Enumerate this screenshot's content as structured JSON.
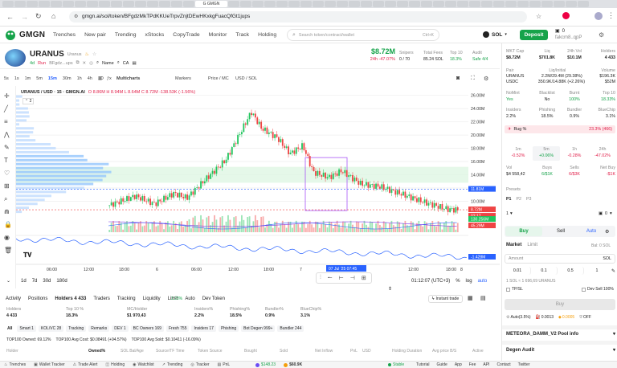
{
  "browser": {
    "tabs_count": 60,
    "active_tab": "G GMGN",
    "url": "gmgn.ai/sol/token/BFgdzMkTPdKKUeTrpvZnjtDEwHKxkgFuacQfGt1jups"
  },
  "app": {
    "logo": "GMGN",
    "nav": [
      "Trenches",
      "New pair",
      "Trending",
      "xStocks",
      "CopyTrade",
      "Monitor",
      "Track",
      "Holding"
    ],
    "search_placeholder": "Search token/contract/wallet",
    "search_shortcut": "Ctrl+K",
    "chain": "SOL",
    "deposit": "Deposit",
    "wallet_balance": "0",
    "wallet_name": "fakcm8..qpP"
  },
  "token": {
    "symbol": "URANUS",
    "name": "Uranus",
    "age": "4d",
    "run": "Run",
    "address": "BFgdz...ups",
    "name_label": "Name",
    "ca_label": "CA",
    "price": "$8.72M",
    "change": "24h -47.07%",
    "snipers_label": "Snipers",
    "snipers": "0 / 70",
    "total_fees_label": "Total Fees",
    "total_fees": "85.24 SOL",
    "top10_label": "Top 10",
    "top10": "18.3%",
    "audit_label": "Audit",
    "audit": "Safe 4/4"
  },
  "chart": {
    "intervals": [
      "5s",
      "1s",
      "1m",
      "5m",
      "15m",
      "30m",
      "1h",
      "4h",
      "1D"
    ],
    "active_interval": "15m",
    "toolbar": [
      "Multicharts",
      "Markers",
      "Price / MC",
      "USD / SOL"
    ],
    "legend": "URANUS / USD · 15 · GMGN.AI",
    "ohlc": "O 8.86M H 8.94M L 8.64M C 8.72M -138.53K (-1.56%)",
    "legend_count": "2",
    "price_axis": [
      "26.00M",
      "24.00M",
      "22.00M",
      "20.00M",
      "18.00M",
      "16.00M",
      "14.00M",
      "12.00M",
      "10.00M"
    ],
    "price_tags": [
      "11.81M",
      "8.72M",
      "02:17",
      "130.256M",
      "45.29M"
    ],
    "indicator_tag": "-1.428M",
    "time_axis": [
      "06:00",
      "12:00",
      "18:00",
      "6",
      "06:00",
      "12:00",
      "18:00",
      "7",
      "12:00",
      "18:00",
      "8"
    ],
    "time_tag": "07 Jul '25 07:45",
    "ranges": [
      "1d",
      "7d",
      "30d",
      "180d"
    ],
    "clock": "01:12:07 (UTC+3)",
    "scale_options": [
      "%",
      "log",
      "auto"
    ]
  },
  "bottom": {
    "tabs": [
      "Activity",
      "Positions",
      "Holders 4 433",
      "Traders",
      "Tracking",
      "Liquidity",
      "Limit",
      "Auto",
      "Dev Token"
    ],
    "holders_pct": "2.23%",
    "instant_trade": "Instant trade",
    "stats": [
      {
        "label": "Holders",
        "value": "4 433"
      },
      {
        "label": "Top 10 %",
        "value": "18.3%"
      },
      {
        "label": "MC/Holder",
        "value": "$1 970,43"
      },
      {
        "label": "Insiders%",
        "value": "2.2%"
      },
      {
        "label": "Phishing%",
        "value": "18.5%"
      },
      {
        "label": "Bundler%",
        "value": "0.9%"
      },
      {
        "label": "BlueChip%",
        "value": "3.1%"
      }
    ],
    "filters": [
      "All",
      "Smart 1",
      "KOL/VC 28",
      "Tracking",
      "Remarks",
      "DEV 1",
      "BC Owners 169",
      "Fresh 755",
      "Insiders 17",
      "Phishing",
      "Bot Degen 999+",
      "Bundler 244"
    ],
    "summary": [
      "TOP100 Owned: 69.12%",
      "TOP100 Avg Cost: $0.08491 (+94.57%)",
      "TOP100 Avg Sold: $0.10411 (-16.09%)"
    ],
    "columns": [
      "Holder",
      "Owned%",
      "SOL Bal/Age",
      "Source/TF Time",
      "Token Source",
      "Bought",
      "Sold",
      "Net Inflow",
      "PnL",
      "USD",
      "Holding Duration",
      "Avg price B/S",
      "Active"
    ]
  },
  "right": {
    "stats": [
      {
        "label": "MKT Cap",
        "value": "$8.72M"
      },
      {
        "label": "Liq",
        "value": "$701.8K"
      },
      {
        "label": "24h Vol",
        "value": "$10.1M"
      },
      {
        "label": "Holders",
        "value": "4 433"
      }
    ],
    "pair": {
      "label": "Pair",
      "liq_label": "Liq/Initial",
      "vol_label": "Volume",
      "base": "URANUS",
      "base_amt": "2.2M/29.4M (29.38%)",
      "base_vol": "$196.3K",
      "quote": "USDC",
      "quote_amt": "350.9K/14.88K (+2.26%)",
      "quote_vol": "$52M"
    },
    "security": [
      {
        "label": "NoMint",
        "value": "Yes"
      },
      {
        "label": "Blacklist",
        "value": "No"
      },
      {
        "label": "Burnt",
        "value": "100%"
      },
      {
        "label": "Top 10",
        "value": "18.33%"
      }
    ],
    "security2": [
      {
        "label": "Insiders",
        "value": "2.2%"
      },
      {
        "label": "Phishing",
        "value": "18.5%"
      },
      {
        "label": "Bundler",
        "value": "0.9%"
      },
      {
        "label": "BlueChip",
        "value": "3.1%"
      }
    ],
    "rug_label": "Rug %",
    "rug_value": "23.3% (466)",
    "changes": [
      {
        "label": "1m",
        "value": "-0.52%"
      },
      {
        "label": "5m",
        "value": "+0.06%"
      },
      {
        "label": "1h",
        "value": "-0.28%"
      },
      {
        "label": "24h",
        "value": "-47.02%"
      }
    ],
    "vol_stats": [
      {
        "label": "Vol",
        "value": "$4 558,42"
      },
      {
        "label": "Buys",
        "value": "6/$1K"
      },
      {
        "label": "Sells",
        "value": "6/$3K"
      },
      {
        "label": "Net Buy",
        "value": "-$1K"
      }
    ],
    "presets_label": "Presets",
    "presets": [
      "P1",
      "P2",
      "P3"
    ],
    "quick_label": "1",
    "quick_amount": "0",
    "trade_tabs": [
      "Buy",
      "Sell",
      "Auto"
    ],
    "order_tabs": [
      "Market",
      "Limit"
    ],
    "balance": "Bal: 0 SOL",
    "amount_placeholder": "Amount",
    "amount_unit": "SOL",
    "amounts": [
      "0.01",
      "0.1",
      "0.5",
      "1"
    ],
    "rate": "1 SOL ≈ 1 696,69 URANUS",
    "tpsl": "TP/SL",
    "dev_sell": "Dev Sell 100%",
    "buy_button": "Buy",
    "settings": [
      "Auto(3.5%)",
      "0.0013",
      "0.0005",
      "OFF"
    ],
    "pool_info": "METEORA_DAMM_V2 Pool info",
    "degen_audit": "Degen Audit"
  },
  "taskbar": {
    "items": [
      "Trenches",
      "Wallet Tracker",
      "Trade Alert",
      "Holding",
      "Watchlist",
      "Trending",
      "Tracker",
      "PnL"
    ],
    "sol_price": "$148.23",
    "balance": "$60.9K",
    "status": "Stable",
    "right": [
      "Tutorial",
      "Guide",
      "App",
      "Fee",
      "API",
      "Contact",
      "Twitter"
    ]
  },
  "colors": {
    "up": "#22c55e",
    "down": "#ef4444",
    "accent": "#16a34a",
    "deposit": "#16a34a",
    "sell": "#e11d48"
  }
}
